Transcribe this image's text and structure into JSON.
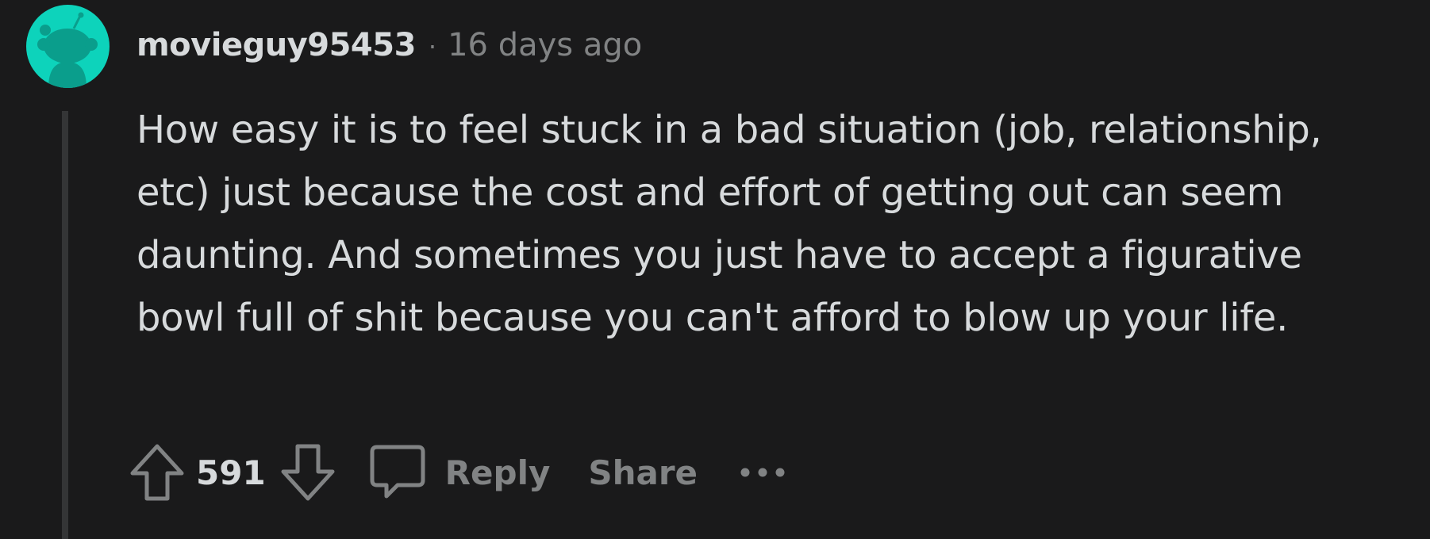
{
  "colors": {
    "background": "#1a1a1b",
    "avatar_bg": "#0dd3bb",
    "text_primary": "#d7dadc",
    "text_secondary": "#818384",
    "thread_line": "#343536"
  },
  "comment": {
    "avatar_icon": "snoo-avatar-icon",
    "username": "movieguy95453",
    "separator": "·",
    "timestamp": "16 days ago",
    "body": "How easy it is to feel stuck in a bad situation (job, relationship, etc) just because the cost and effort of getting out can seem daunting. And sometimes you just have to accept a figurative bowl full of shit because you can't afford to blow up your life."
  },
  "actions": {
    "upvote_icon": "upvote-arrow-icon",
    "vote_count": "591",
    "downvote_icon": "downvote-arrow-icon",
    "reply_icon": "comment-bubble-icon",
    "reply_label": "Reply",
    "share_label": "Share",
    "more_icon": "more-options-icon"
  }
}
